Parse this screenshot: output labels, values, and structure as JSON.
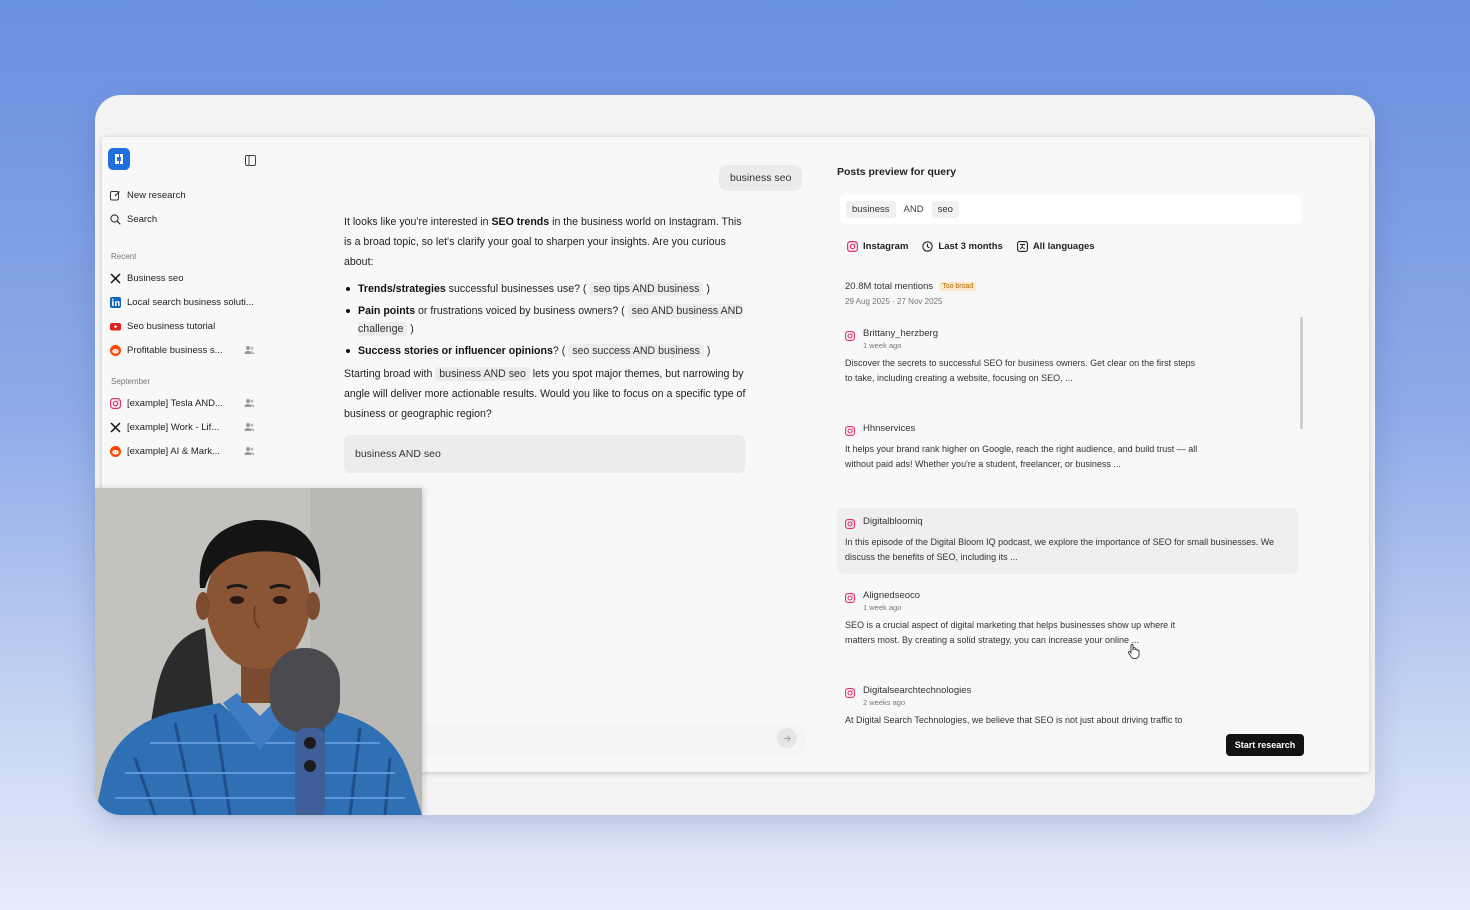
{
  "sidebar": {
    "nav": [
      {
        "label": "New research",
        "icon": "edit-icon"
      },
      {
        "label": "Search",
        "icon": "search-icon"
      }
    ],
    "recent_label": "Recent",
    "recent": [
      {
        "label": "Business seo",
        "icon": "x-icon",
        "shared": false
      },
      {
        "label": "Local search business soluti...",
        "icon": "linkedin-icon",
        "shared": false
      },
      {
        "label": "Seo business tutorial",
        "icon": "youtube-icon",
        "shared": false
      },
      {
        "label": "Profitable business s...",
        "icon": "reddit-icon",
        "shared": true
      }
    ],
    "september_label": "September",
    "september": [
      {
        "label": "[example] Tesla AND...",
        "icon": "instagram-icon",
        "shared": true
      },
      {
        "label": "[example] Work - Lif...",
        "icon": "x-icon",
        "shared": true
      },
      {
        "label": "[example] AI & Mark...",
        "icon": "reddit-icon",
        "shared": true
      }
    ]
  },
  "chat": {
    "user_message": "business seo",
    "intro_1": "It looks like you're interested in ",
    "intro_bold": "SEO trends",
    "intro_2": " in the business world on Instagram. This is a broad topic, so let's clarify your goal to sharpen your insights. Are you curious about:",
    "bullets": [
      {
        "bold": "Trends/strategies",
        "text": " successful businesses use? ( ",
        "code": "seo tips AND business",
        "end": " )"
      },
      {
        "bold": "Pain points",
        "text": " or frustrations voiced by business owners? ( ",
        "code": "seo AND business AND challenge",
        "end": " )"
      },
      {
        "bold": "Success stories or influencer opinions",
        "text": "? ( ",
        "code": "seo success AND business",
        "end": " )"
      }
    ],
    "outro_1": "Starting broad with ",
    "outro_code": "business AND seo",
    "outro_2": " lets you spot major themes, but narrowing by angle will deliver more actionable results. Would you like to focus on a specific type of business or geographic region?",
    "suggested_query": "business AND seo"
  },
  "preview": {
    "title": "Posts preview for query",
    "query_tokens": [
      "business",
      "AND",
      "seo"
    ],
    "filters": [
      {
        "label": "Instagram",
        "icon": "instagram-icon"
      },
      {
        "label": "Last 3 months",
        "icon": "clock-icon"
      },
      {
        "label": "All languages",
        "icon": "language-icon"
      }
    ],
    "mentions": "20.8M total mentions",
    "badge": "Too broad",
    "date_range": "29 Aug 2025 - 27 Nov 2025",
    "posts": [
      {
        "author": "Brittany_herzberg",
        "time": "1 week ago",
        "text": "Discover the secrets to successful SEO for business owners. Get clear on the first steps to take, including creating a website, focusing on SEO, ..."
      },
      {
        "author": "Hhnservices",
        "time": "",
        "text": "It helps your brand rank higher on Google, reach the right audience, and build trust — all without paid ads! Whether you're a student, freelancer, or business ..."
      },
      {
        "author": "Digitalbloomiq",
        "time": "",
        "text": "In this episode of the Digital Bloom IQ podcast, we explore the importance of SEO for small businesses. We discuss the benefits of SEO, including its ..."
      },
      {
        "author": "Alignedseoco",
        "time": "1 week ago",
        "text": "SEO is a crucial aspect of digital marketing that helps businesses show up where it matters most. By creating a solid strategy, you can increase your online ..."
      },
      {
        "author": "Digitalsearchtechnologies",
        "time": "2 weeks ago",
        "text": "At Digital Search Technologies, we believe that SEO is not just about driving traffic to"
      }
    ],
    "start_button": "Start research"
  },
  "colors": {
    "background_top": "#6a90e0",
    "logo_blue": "#1f6fe0",
    "badge_text": "#b06a12",
    "badge_bg": "#fbe9c9",
    "button_dark": "#121214",
    "shirt_blue": "#2f6fb4"
  }
}
